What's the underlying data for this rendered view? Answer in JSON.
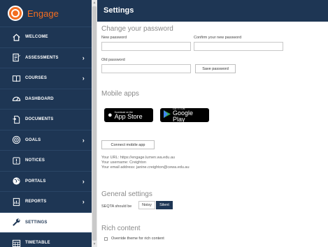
{
  "brand": {
    "name": "Engage",
    "accent": "#f26d21",
    "nav_bg": "#1e3654"
  },
  "nav": [
    {
      "label": "WELCOME",
      "icon": "house-icon",
      "chevron": false,
      "active": false
    },
    {
      "label": "ASSESSMENTS",
      "icon": "assessment-icon",
      "chevron": true,
      "active": false
    },
    {
      "label": "COURSES",
      "icon": "book-icon",
      "chevron": true,
      "active": false
    },
    {
      "label": "DASHBOARD",
      "icon": "dashboard-icon",
      "chevron": false,
      "active": false
    },
    {
      "label": "DOCUMENTS",
      "icon": "document-icon",
      "chevron": false,
      "active": false
    },
    {
      "label": "GOALS",
      "icon": "target-icon",
      "chevron": true,
      "active": false
    },
    {
      "label": "NOTICES",
      "icon": "notice-icon",
      "chevron": false,
      "active": false
    },
    {
      "label": "PORTALS",
      "icon": "globe-icon",
      "chevron": true,
      "active": false
    },
    {
      "label": "REPORTS",
      "icon": "report-icon",
      "chevron": true,
      "active": false
    },
    {
      "label": "SETTINGS",
      "icon": "wrench-icon",
      "chevron": false,
      "active": true
    },
    {
      "label": "TIMETABLE",
      "icon": "calendar-icon",
      "chevron": false,
      "active": false
    }
  ],
  "header": {
    "title": "Settings"
  },
  "password": {
    "title": "Change your password",
    "new_label": "New password",
    "confirm_label": "Confirm your new password",
    "old_label": "Old password",
    "save_label": "Save password"
  },
  "mobile": {
    "title": "Mobile apps",
    "appstore_small": "Download on the",
    "appstore_big": "App Store",
    "play_small": "GET IT ON",
    "play_big": "Google Play",
    "connect_label": "Connect mobile app",
    "url_line": "Your URL: https://engage.lumen.wa.edu.au",
    "username_line": "Your username: Creighton",
    "email_line": "Your email address: janine.creighton@cewa.edu.au"
  },
  "general": {
    "title": "General settings",
    "should_be_label": "SEQTA should be",
    "noisy_label": "Noisy",
    "silent_label": "Silent"
  },
  "rich": {
    "title": "Rich content",
    "override_label": "Override theme for rich content"
  }
}
